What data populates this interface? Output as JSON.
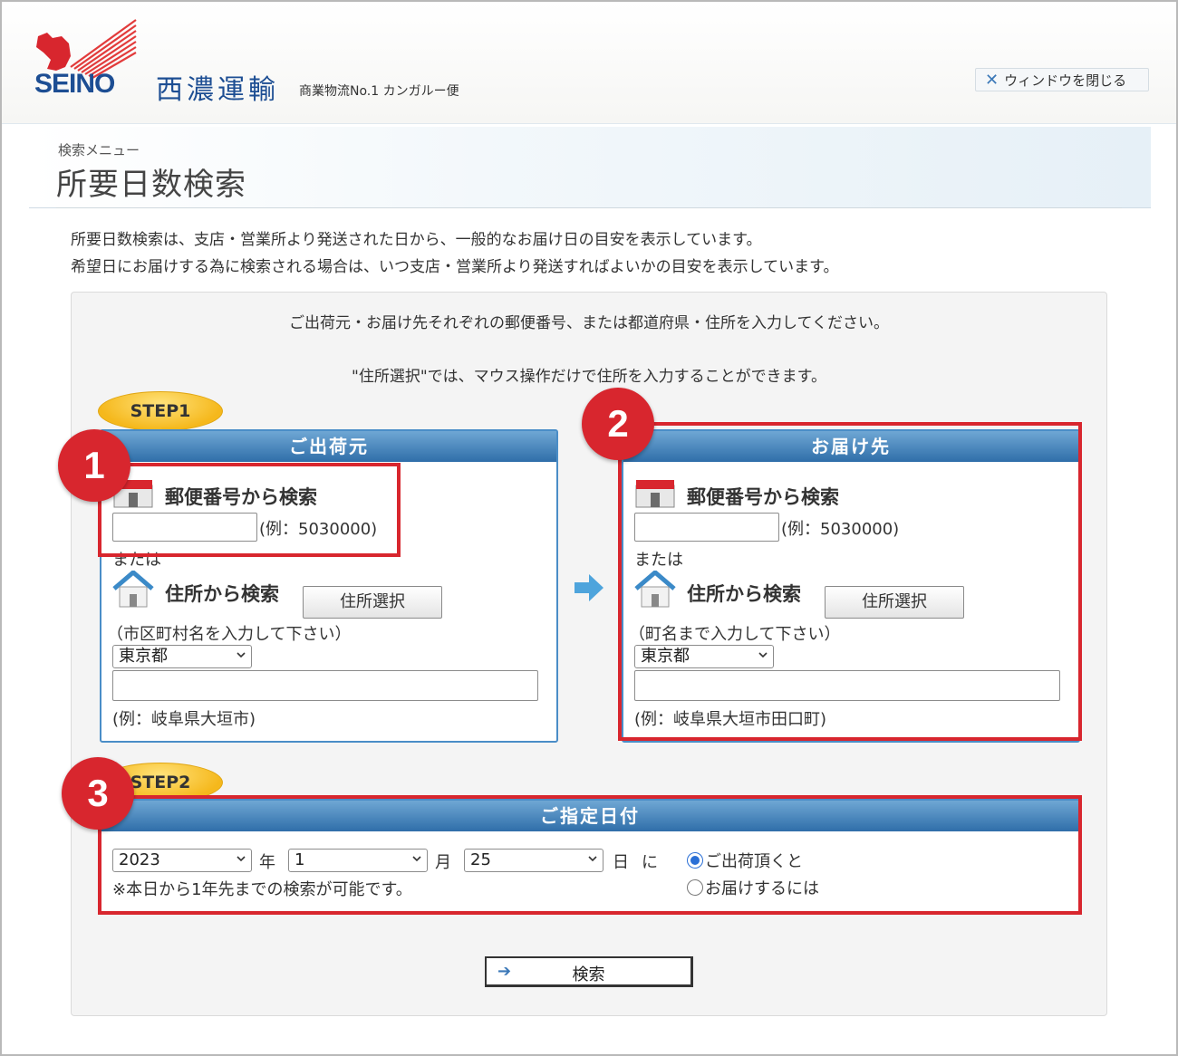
{
  "header": {
    "logo_text": "SEINO",
    "company_name": "西濃運輸",
    "tagline": "商業物流No.1 カンガルー便",
    "close_button": "ウィンドウを閉じる"
  },
  "page": {
    "breadcrumb": "検索メニュー",
    "title": "所要日数検索",
    "intro_line1": "所要日数検索は、支店・営業所より発送された日から、一般的なお届け日の目安を表示しています。",
    "intro_line2": "希望日にお届けする為に検索される場合は、いつ支店・営業所より発送すればよいかの目安を表示しています。"
  },
  "form": {
    "notice1": "ご出荷元・お届け先それぞれの郵便番号、または都道府県・住所を入力してください。",
    "notice2": "\"住所選択\"では、マウス操作だけで住所を入力することができます。",
    "step1_label": "STEP1",
    "step2_label": "STEP2",
    "origin": {
      "heading": "ご出荷元",
      "postal_title": "郵便番号から検索",
      "postal_example": "(例：5030000)",
      "or_text": "または",
      "address_title": "住所から検索",
      "address_select_button": "住所選択",
      "address_hint": "（市区町村名を入力して下さい）",
      "prefecture": "東京都",
      "address_example": "(例：岐阜県大垣市)"
    },
    "destination": {
      "heading": "お届け先",
      "postal_title": "郵便番号から検索",
      "postal_example": "(例：5030000)",
      "or_text": "または",
      "address_title": "住所から検索",
      "address_select_button": "住所選択",
      "address_hint": "（町名まで入力して下さい）",
      "prefecture": "東京都",
      "address_example": "(例：岐阜県大垣市田口町)"
    },
    "date": {
      "heading": "ご指定日付",
      "year": "2023",
      "year_unit": "年",
      "month": "1",
      "month_unit": "月",
      "day": "25",
      "day_unit": "日",
      "particle": "に",
      "note": "※本日から1年先までの検索が可能です。",
      "radio_ship": "ご出荷頂くと",
      "radio_deliver": "お届けするには",
      "selected": "ship"
    },
    "search_button": "検索"
  },
  "annotations": {
    "badge1": "1",
    "badge2": "2",
    "badge3": "3",
    "color": "#d8262e"
  }
}
